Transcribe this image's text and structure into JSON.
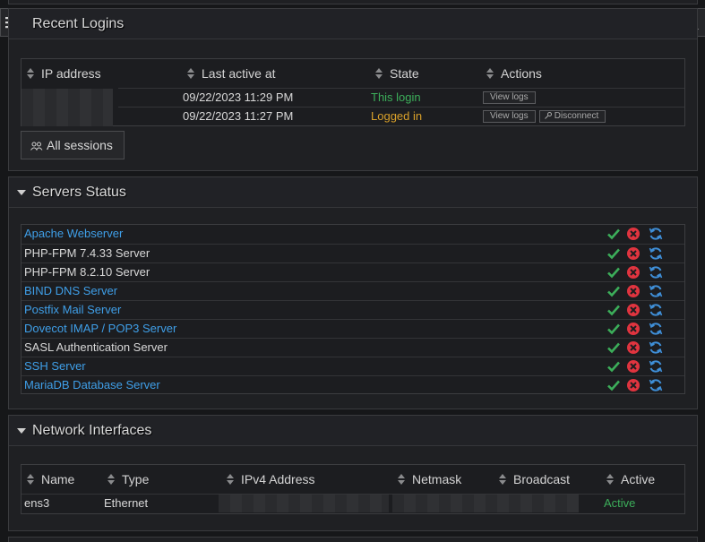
{
  "recent_logins": {
    "title": "Recent Logins",
    "columns": [
      "IP address",
      "Last active at",
      "State",
      "Actions"
    ],
    "rows": [
      {
        "last_active": "09/22/2023 11:29 PM",
        "state": "This login",
        "view_logs": "View logs"
      },
      {
        "last_active": "09/22/2023 11:27 PM",
        "state": "Logged in",
        "view_logs": "View logs",
        "disconnect": "Disconnect"
      }
    ],
    "all_sessions": "All sessions"
  },
  "servers": {
    "title": "Servers Status",
    "items": [
      {
        "name": "Apache Webserver",
        "link": true
      },
      {
        "name": "PHP-FPM 7.4.33 Server",
        "link": false
      },
      {
        "name": "PHP-FPM 8.2.10 Server",
        "link": false
      },
      {
        "name": "BIND DNS Server",
        "link": true
      },
      {
        "name": "Postfix Mail Server",
        "link": true
      },
      {
        "name": "Dovecot IMAP / POP3 Server",
        "link": true
      },
      {
        "name": "SASL Authentication Server",
        "link": false
      },
      {
        "name": "SSH Server",
        "link": true
      },
      {
        "name": "MariaDB Database Server",
        "link": true
      }
    ]
  },
  "network": {
    "title": "Network Interfaces",
    "columns": [
      "Name",
      "Type",
      "IPv4 Address",
      "Netmask",
      "Broadcast",
      "Active"
    ],
    "rows": [
      {
        "name": "ens3",
        "type": "Ethernet",
        "active": "Active"
      }
    ]
  },
  "colors": {
    "accent": "#3f9fe8",
    "ok": "#3cae5a",
    "stop": "#e0343f",
    "restart": "#3f8fd8",
    "warn": "#d8a02a"
  }
}
